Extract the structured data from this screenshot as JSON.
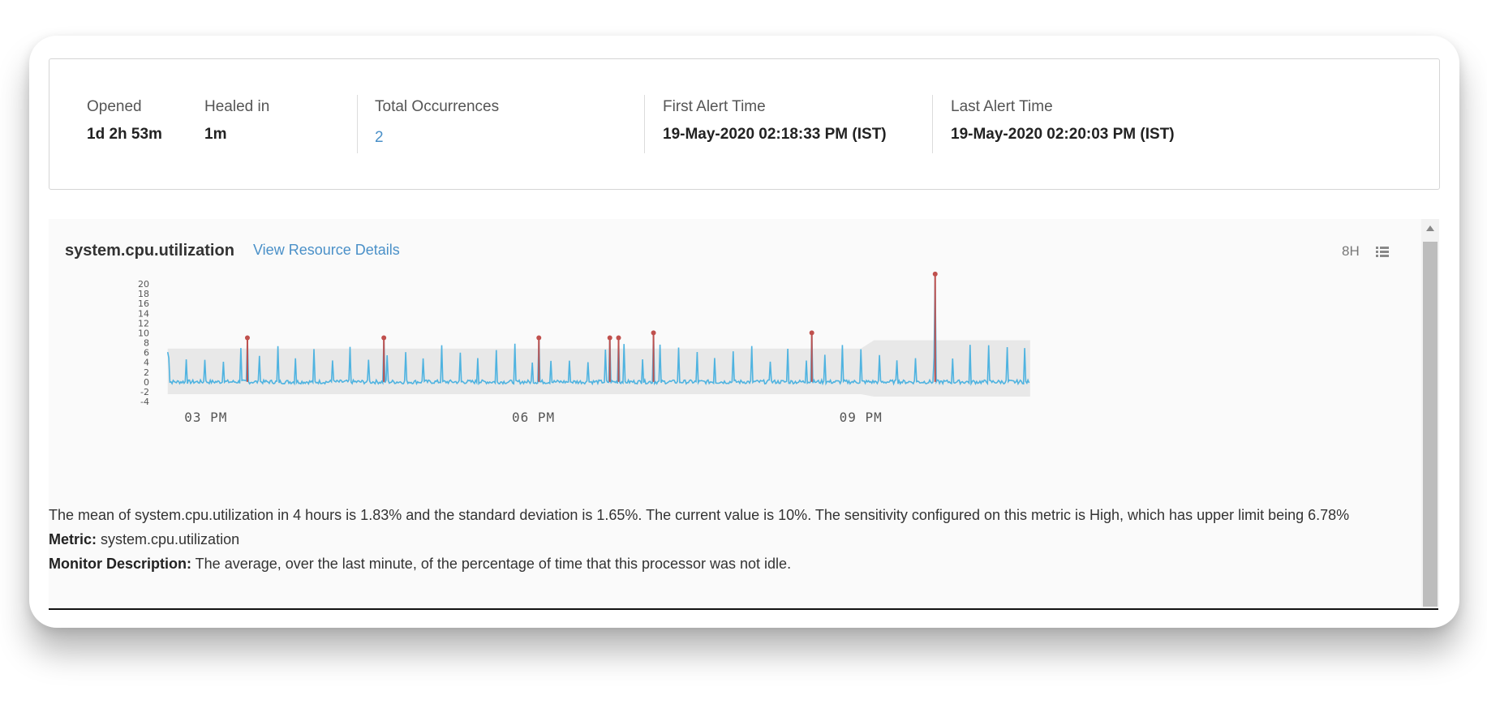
{
  "summary": {
    "opened": {
      "label": "Opened",
      "value": "1d 2h 53m"
    },
    "healed": {
      "label": "Healed in",
      "value": "1m"
    },
    "occurrences": {
      "label": "Total Occurrences",
      "value": "2"
    },
    "first_alert": {
      "label": "First Alert Time",
      "value": "19-May-2020 02:18:33 PM (IST)"
    },
    "last_alert": {
      "label": "Last Alert Time",
      "value": "19-May-2020 02:20:03 PM (IST)"
    }
  },
  "panel": {
    "metric": "system.cpu.utilization",
    "resource_link": "View Resource Details",
    "range": "8H",
    "icon": "list-icon"
  },
  "chart_data": {
    "type": "line",
    "ylim": [
      -4,
      20
    ],
    "yticks": [
      "20",
      "18",
      "16",
      "14",
      "12",
      "10",
      "8",
      "6",
      "4",
      "2",
      "0",
      "-2",
      "-4"
    ],
    "xticks": [
      "03 PM",
      "06 PM",
      "09 PM"
    ],
    "xlim": [
      14.6,
      22.7
    ],
    "band_upper_before": 6.8,
    "band_lower_before": -2.5,
    "band_upper_after": 8.5,
    "band_lower_after": -3.0,
    "band_change_hour": 21.0,
    "series_end_hour": 22.55,
    "baseline": 0.0,
    "spike_period_hours": 0.167,
    "spike_height": 6.5,
    "anomalies": [
      {
        "x": 15.38,
        "y": 9.0
      },
      {
        "x": 16.63,
        "y": 9.0
      },
      {
        "x": 18.05,
        "y": 9.0
      },
      {
        "x": 18.7,
        "y": 9.0
      },
      {
        "x": 18.78,
        "y": 9.0
      },
      {
        "x": 19.1,
        "y": 10.0
      },
      {
        "x": 20.55,
        "y": 10.0
      },
      {
        "x": 21.68,
        "y": 22.0
      }
    ],
    "colors": {
      "line": "#4fb3e0",
      "anomaly": "#c0504d",
      "band": "#e8e8e8"
    }
  },
  "description": {
    "summary": "The mean of system.cpu.utilization in 4 hours is 1.83% and the standard deviation is 1.65%. The current value is 10%. The sensitivity configured on this metric is High, which has upper limit being 6.78%",
    "metric_label": "Metric:",
    "metric_value": " system.cpu.utilization",
    "monitor_label": "Monitor Description:",
    "monitor_value": " The average, over the last minute, of the percentage of time that this processor was not idle."
  }
}
